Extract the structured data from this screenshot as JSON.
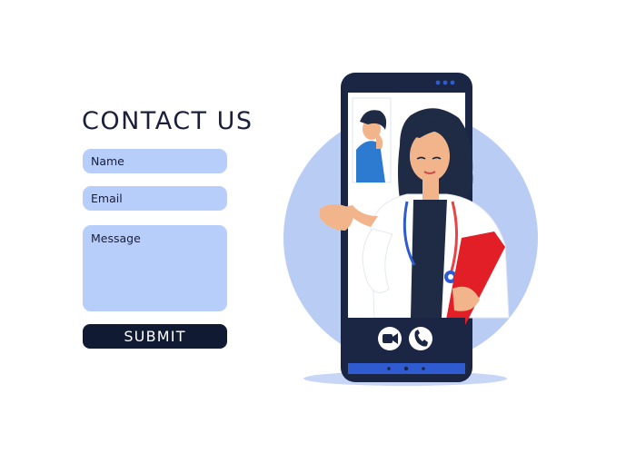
{
  "contact": {
    "title": "CONTACT US",
    "name_placeholder": "Name",
    "email_placeholder": "Email",
    "message_placeholder": "Message",
    "submit_label": "SUBMIT"
  },
  "colors": {
    "field_bg": "#b7cdfa",
    "submit_bg": "#111a33",
    "circle_bg": "#b9ccf3",
    "phone_frame": "#1b2544",
    "phone_accent": "#2f5bd0",
    "folder_red": "#e21f26"
  },
  "phone": {
    "call_buttons": [
      "video-camera-icon",
      "phone-call-icon"
    ]
  }
}
